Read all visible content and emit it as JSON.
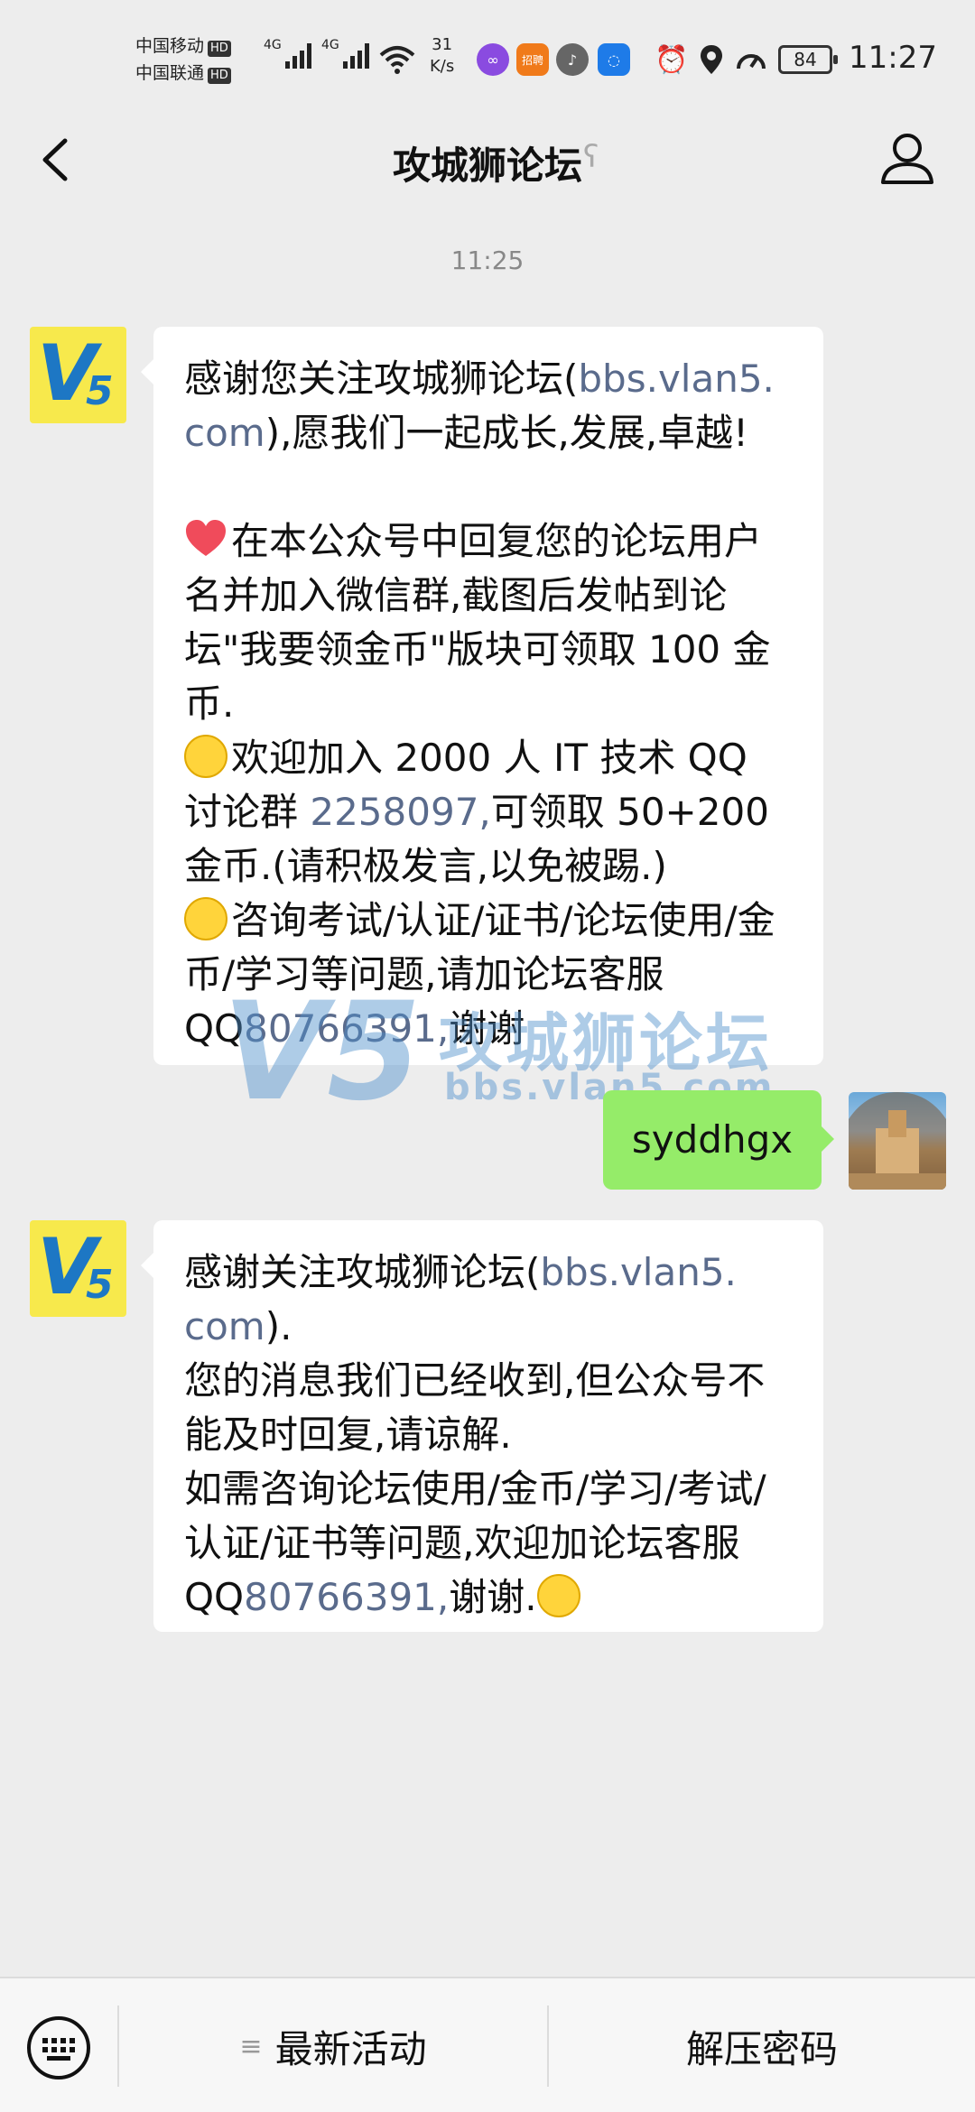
{
  "status_bar": {
    "carrier_1": "中国移动",
    "carrier_2": "中国联通",
    "hd_badge": "HD",
    "network_1": "4G",
    "network_2": "4G",
    "net_speed_value": "31",
    "net_speed_unit": "K/s",
    "battery_level": "84",
    "time": "11:27"
  },
  "nav": {
    "title": "攻城狮论坛"
  },
  "chat": {
    "timestamp": "11:25",
    "msg1": {
      "l1": "感谢您关注攻城狮论坛(",
      "l1_link": "bbs.vlan5.",
      "l2_link": "com",
      "l2": "),愿我们一起成长,发展,卓越!",
      "p2": "在本公众号中回复您的论坛用户名并加入微信群,截图后发帖到论坛\"我要领金币\"版块可领取 100 金币.",
      "p3a": "欢迎加入 2000 人 IT 技术 QQ 讨论群 ",
      "p3_link": "2258097,",
      "p3b": "可领取 50+200 金币.(请积极发言,以免被踢.)",
      "p4a": "咨询考试/认证/证书/论坛使用/金币/学习等问题,请加论坛客服QQ",
      "p4_link": "80766391,",
      "p4b": "谢谢"
    },
    "my_message": "syddhgx",
    "msg2": {
      "l1": "感谢关注攻城狮论坛(",
      "l1_link": "bbs.vlan5.",
      "l2_link": "com",
      "l2": ").",
      "p2": "您的消息我们已经收到,但公众号不能及时回复,请谅解.",
      "p3a": "如需咨询论坛使用/金币/学习/考试/认证/证书等问题,欢迎加论坛客服 QQ",
      "p3_link": "80766391,",
      "p3b": "谢谢."
    },
    "watermark": {
      "logo": "V5",
      "title": "攻城狮论坛",
      "url": "bbs.vlan5.com"
    }
  },
  "bottom_menu": {
    "item1_icon": "≡",
    "item1": "最新活动",
    "item2": "解压密码"
  },
  "colors": {
    "background": "#ededed",
    "link": "#5a6b8c",
    "my_bubble": "#95ec69",
    "avatar_yellow": "#f7e94c",
    "avatar_blue": "#1d77c4"
  }
}
